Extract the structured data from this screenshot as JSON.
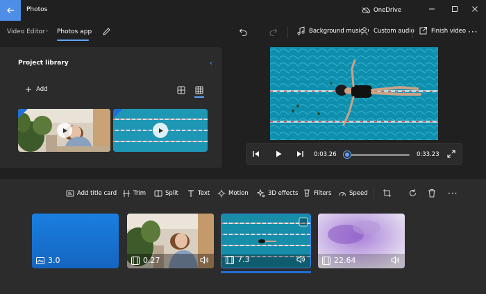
{
  "titlebar": {
    "app_title": "Photos",
    "onedrive_label": "OneDrive",
    "controls": [
      "minimize-icon",
      "maximize-icon",
      "close-icon"
    ]
  },
  "breadcrumb": {
    "parent": "Video Editor",
    "current": "Photos app"
  },
  "toolbar": {
    "undo_icon": "undo-icon",
    "redo_icon": "redo-icon",
    "background_music": "Background music",
    "custom_audio": "Custom audio",
    "finish_video": "Finish video",
    "more_icon": "more-icon"
  },
  "library": {
    "title": "Project library",
    "add_label": "Add",
    "items": [
      {
        "kind": "video",
        "subject": "woman-with-plants"
      },
      {
        "kind": "video",
        "subject": "swimming-pool"
      }
    ]
  },
  "player": {
    "current_time": "0:03.26",
    "total_time": "0:33.23",
    "progress": 0.1
  },
  "storyboard_tools": {
    "add_title_card": "Add title card",
    "trim": "Trim",
    "split": "Split",
    "text": "Text",
    "motion": "Motion",
    "effects_3d": "3D effects",
    "filters": "Filters",
    "speed": "Speed"
  },
  "clips": [
    {
      "duration": "3.0",
      "type": "title-card",
      "audio": false,
      "selected": false
    },
    {
      "duration": "0.27",
      "type": "video",
      "audio": true,
      "selected": false
    },
    {
      "duration": "7.3",
      "type": "video",
      "audio": true,
      "selected": true
    },
    {
      "duration": "22.64",
      "type": "video",
      "audio": true,
      "selected": false
    }
  ],
  "colors": {
    "accent": "#60a5fa",
    "selection": "#1f6fd6",
    "back_button": "#4f8ee6",
    "title_card_blue": "#1a7fe0"
  }
}
